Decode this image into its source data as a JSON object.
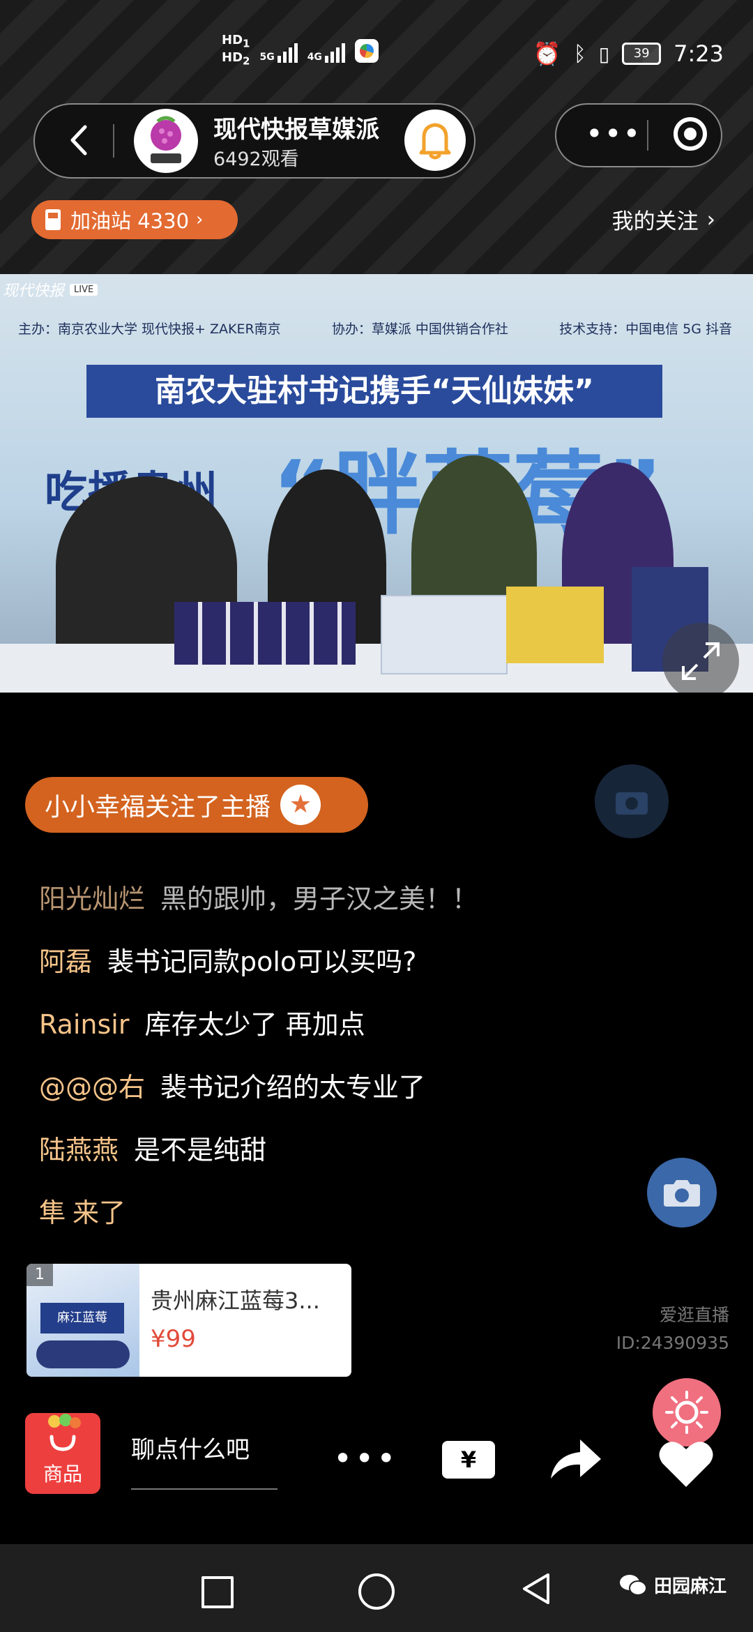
{
  "status_bar": {
    "hd1": "HD",
    "hd1_sub": "1",
    "hd2": "HD",
    "hd2_sub": "2",
    "net1": "5G",
    "net2": "4G",
    "battery": "39",
    "time": "7:23"
  },
  "header": {
    "title": "现代快报草媒派",
    "viewers": "6492观看",
    "gas_station": "加油站 4330",
    "my_follow": "我的关注"
  },
  "video": {
    "watermark": "现代快报",
    "live_tag": "LIVE",
    "sponsor": "主办：南京农业大学 现代快报+ ZAKER南京",
    "co_organizer": "协办：草媒派 中国供销合作社",
    "tech_support": "技术支持：中国电信 5G 抖音",
    "banner": "南农大驻村书记携手“天仙妹妹”",
    "slogan_left": "吃播贵州",
    "slogan_big": "“胖蓝莓”"
  },
  "follow_notice": {
    "text": "小小幸福关注了主播"
  },
  "chat": [
    {
      "user": "阳光灿烂",
      "message": "黑的跟帅，男子汉之美！！"
    },
    {
      "user": "阿磊",
      "message": "裴书记同款polo可以买吗?"
    },
    {
      "user": "Rainsir",
      "message": "库存太少了 再加点"
    },
    {
      "user": "@@@右",
      "message": "裴书记介绍的太专业了"
    },
    {
      "user": "陆燕燕",
      "message": "是不是纯甜"
    },
    {
      "user": "隼",
      "message": "来了"
    }
  ],
  "product": {
    "index": "1",
    "box_label": "麻江蓝莓",
    "name": "贵州麻江蓝莓3...",
    "price": "¥99"
  },
  "watermark": {
    "line1": "爱逛直播",
    "line2": "ID:24390935"
  },
  "toolbar": {
    "shop_label": "商品",
    "chat_placeholder": "聊点什么吧",
    "more": "•••",
    "ticket": "¥"
  },
  "nav_bar": {
    "wechat_watermark": "田园麻江"
  },
  "colors": {
    "accent_orange": "#e36a31",
    "chat_username": "#f6c48a",
    "price_red": "#e24a3b",
    "shop_red": "#ee3f3f",
    "camera_blue": "#3b68a8"
  },
  "icons": [
    "back-arrow-icon",
    "bell-icon",
    "more-dots-icon",
    "close-circle-icon",
    "gas-pump-icon",
    "chevron-right-icon",
    "expand-icon",
    "star-icon",
    "camera-icon",
    "sun-icon",
    "shopping-bag-icon",
    "ticket-icon",
    "share-icon",
    "heart-icon",
    "nav-square-icon",
    "nav-circle-icon",
    "nav-back-icon",
    "wechat-icon"
  ]
}
